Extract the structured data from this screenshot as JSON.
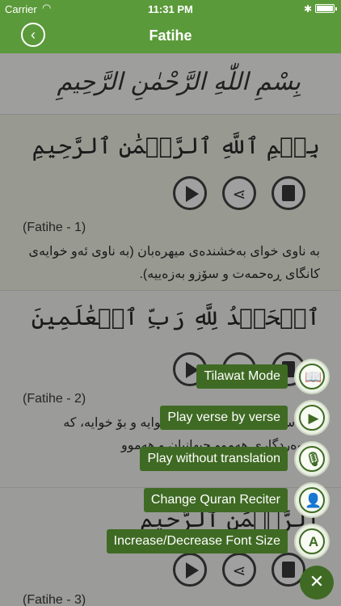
{
  "status": {
    "carrier": "Carrier",
    "time": "11:31 PM"
  },
  "nav": {
    "title": "Fatihe",
    "back_icon": "chevron-left-icon"
  },
  "banner": {
    "calligraphy": "بِسْمِ اللّٰهِ الرَّحْمٰنِ الرَّحِيمِ"
  },
  "verses": [
    {
      "arabic": "بِسۡمِ ٱللَّهِ ٱلرَّحۡمَٰنِ ٱلرَّحِيمِ",
      "ref": "(Fatihe - 1)",
      "translation": "بە ناوی خوای بەخشندەی میهرەبان (بە ناوی ئەو خوایەی کانگای ڕەحمەت و سۆزو بەزەییە)."
    },
    {
      "arabic": "ٱلۡحَمۡدُ لِلَّهِ رَبِّ ٱلۡعَٰلَمِينَ",
      "ref": "(Fatihe - 2)",
      "translation": "سوپاس و ستایش شایستەی خوایە و بۆ خوایە، کە پەروەردگاری هەموو جیهانیان و هەموو"
    },
    {
      "arabic": "ٱلرَّحۡمَٰنِ ٱلرَّحِيمِ",
      "ref": "(Fatihe - 3)"
    }
  ],
  "fab_menu": [
    {
      "label": "Tilawat Mode",
      "icon": "book-open-icon",
      "glyph": "📖"
    },
    {
      "label": "Play verse by verse",
      "icon": "play-icon",
      "glyph": "▶"
    },
    {
      "label": "Play without translation",
      "icon": "microphone-icon",
      "glyph": "🎙"
    },
    {
      "label": "Change Quran Reciter",
      "icon": "reciter-icon",
      "glyph": "👤"
    },
    {
      "label": "Increase/Decrease Font Size",
      "icon": "font-size-icon",
      "glyph": "A"
    }
  ],
  "fab_close": "✕",
  "colors": {
    "primary": "#5b9a3a",
    "dark_green": "#3f6a23"
  }
}
